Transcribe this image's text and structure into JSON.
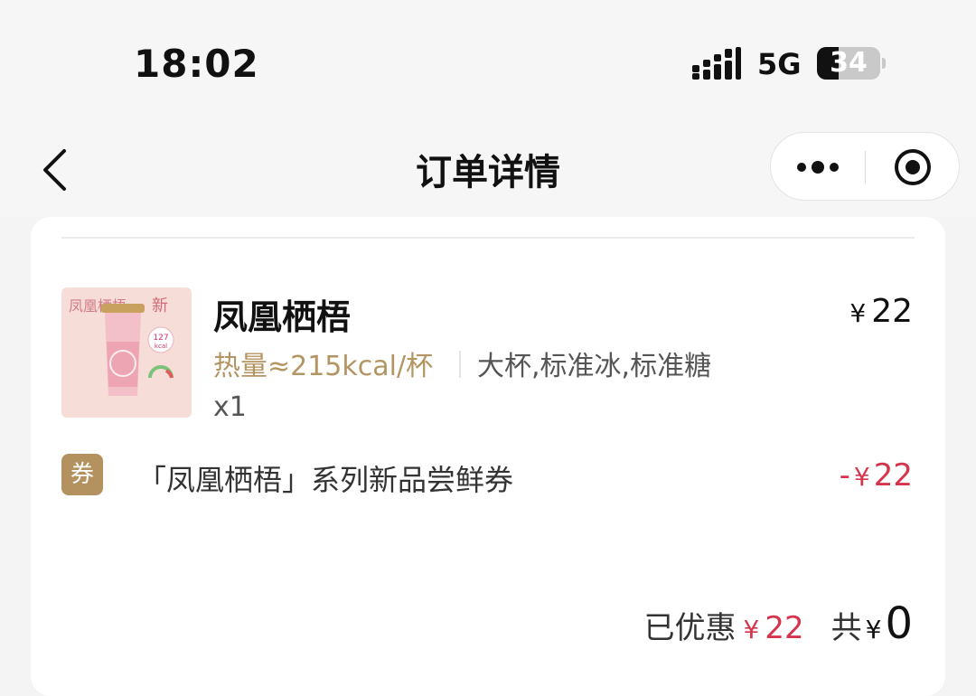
{
  "status_bar": {
    "time": "18:02",
    "network": "5G",
    "battery_level": "34",
    "battery_fraction": 0.34
  },
  "nav": {
    "title": "订单详情",
    "back_icon": "chevron-left-icon",
    "more_icon": "more-dots-icon",
    "close_icon": "target-close-icon"
  },
  "order": {
    "item": {
      "name": "凤凰栖梧",
      "price_currency": "¥",
      "price": "22",
      "calories": "热量≈215kcal/杯",
      "specs": "大杯,标准冰,标准糖",
      "quantity": "x1",
      "thumb": {
        "title": "凤凰栖梧",
        "badge": "新",
        "kcal": "127",
        "kcal_unit": "kcal"
      }
    },
    "coupon": {
      "badge": "券",
      "name": "「凤凰栖梧」系列新品尝鲜券",
      "discount_sign": "-",
      "discount_currency": "¥",
      "discount_value": "22"
    },
    "summary": {
      "saved_label": "已优惠",
      "saved_currency": "¥",
      "saved_value": "22",
      "total_label": "共",
      "total_currency": "¥",
      "total_value": "0"
    }
  },
  "colors": {
    "accent_gold": "#b3925f",
    "discount_red": "#d5344c",
    "page_bg": "#f4f4f4"
  }
}
